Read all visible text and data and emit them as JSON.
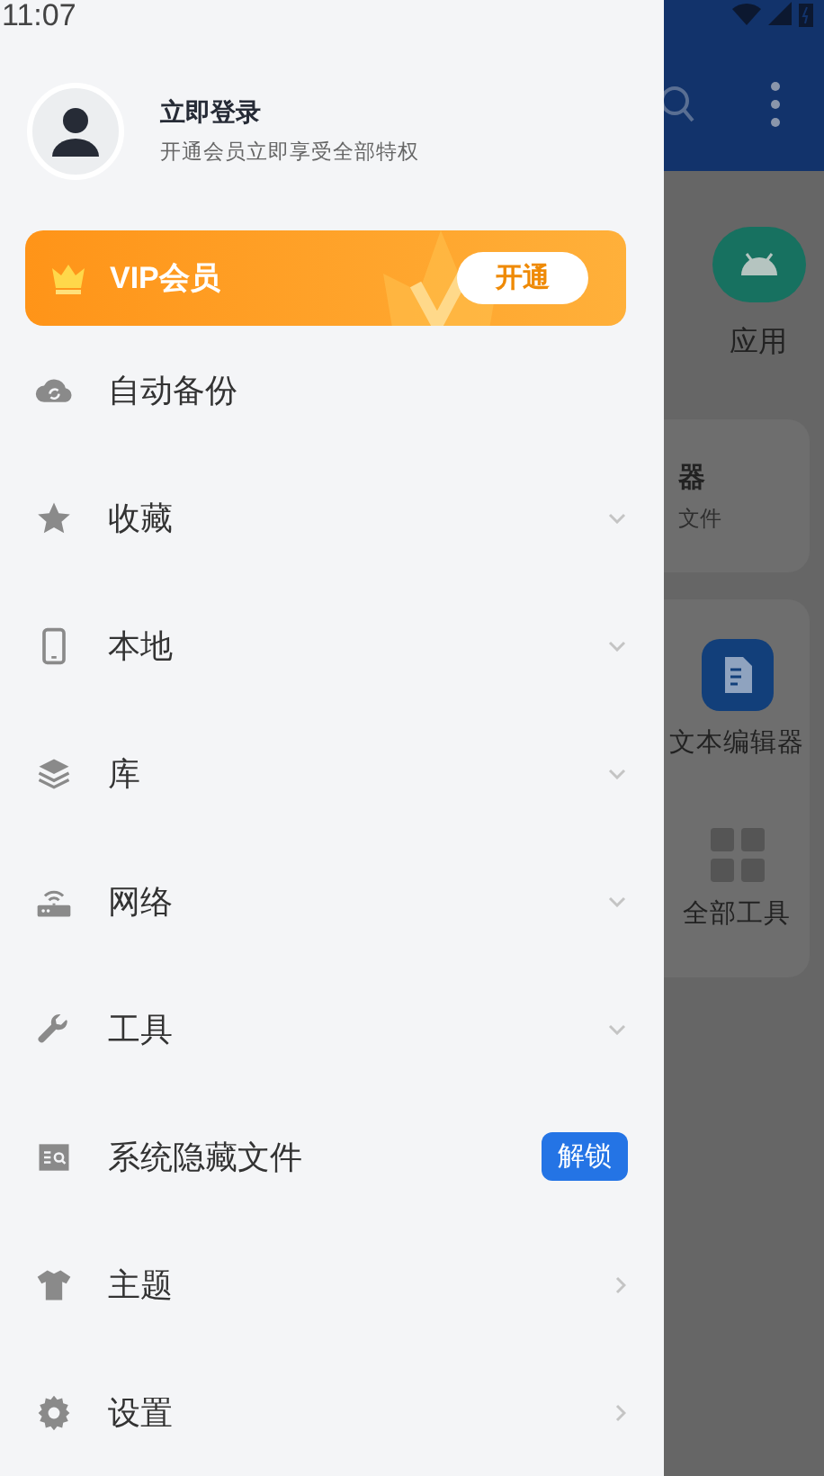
{
  "status_bar": {
    "time": "11:07"
  },
  "drawer": {
    "account": {
      "title": "立即登录",
      "subtitle": "开通会员立即享受全部特权"
    },
    "vip": {
      "label": "VIP会员",
      "button": "开通"
    },
    "items": [
      {
        "label": "自动备份",
        "kind": "plain"
      },
      {
        "label": "收藏",
        "kind": "expandable"
      },
      {
        "label": "本地",
        "kind": "expandable"
      },
      {
        "label": "库",
        "kind": "expandable"
      },
      {
        "label": "网络",
        "kind": "expandable"
      },
      {
        "label": "工具",
        "kind": "expandable"
      },
      {
        "label": "系统隐藏文件",
        "kind": "badge",
        "badge": "解锁"
      },
      {
        "label": "主题",
        "kind": "link"
      },
      {
        "label": "设置",
        "kind": "link"
      }
    ]
  },
  "app_behind": {
    "tile": {
      "label": "应用"
    },
    "card": {
      "title": "器",
      "subtitle": "文件"
    },
    "tools": [
      {
        "label": "文本编辑器"
      },
      {
        "label": "全部工具"
      }
    ]
  }
}
